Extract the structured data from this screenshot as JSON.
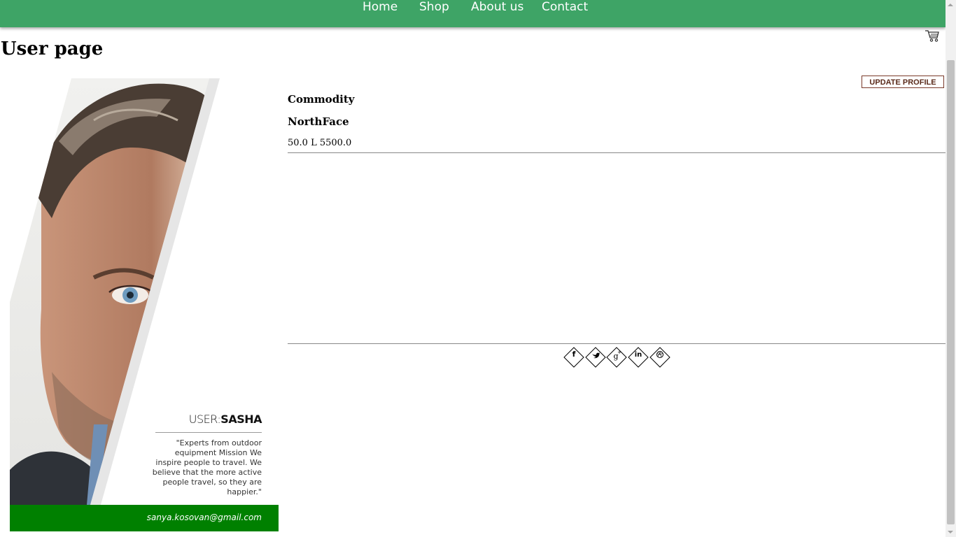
{
  "nav": {
    "items": [
      {
        "label": "Home"
      },
      {
        "label": "Shop"
      },
      {
        "label": "About us"
      },
      {
        "label": "Contact"
      }
    ]
  },
  "header": {
    "cart_icon": "shopping-cart-icon"
  },
  "page": {
    "title": "User page"
  },
  "profile": {
    "prefix": "USER:",
    "name": "SASHA",
    "quote": "\"Experts from outdoor equipment Mission We inspire people to travel. We believe that the more active people travel, so they are happier.\"",
    "email": "sanya.kosovan@gmail.com",
    "photo": "profile-portrait"
  },
  "actions": {
    "update_label": "UPDATE PROFILE"
  },
  "commodity": {
    "title": "Commodity",
    "items": [
      {
        "name": "NorthFace",
        "details": "50.0 L 5500.0"
      }
    ]
  },
  "social": {
    "icons": [
      "facebook-icon",
      "twitter-icon",
      "google-plus-icon",
      "linkedin-icon",
      "dribbble-icon"
    ]
  },
  "colors": {
    "navbar": "#3ea466",
    "email_bar": "#008000",
    "button_border": "#7a3a2a"
  }
}
